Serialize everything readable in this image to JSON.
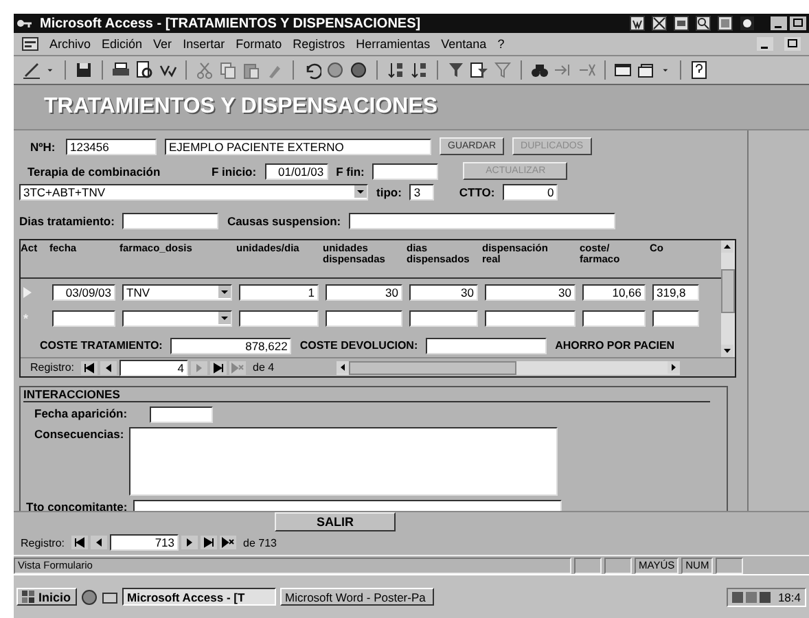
{
  "window": {
    "title": "Microsoft Access - [TRATAMIENTOS Y DISPENSACIONES]"
  },
  "menu": [
    "Archivo",
    "Edición",
    "Ver",
    "Insertar",
    "Formato",
    "Registros",
    "Herramientas",
    "Ventana",
    "?"
  ],
  "form": {
    "heading": "TRATAMIENTOS Y DISPENSACIONES",
    "patient": {
      "label": "NºH:",
      "number": "123456",
      "name": "EJEMPLO PACIENTE EXTERNO"
    },
    "buttons": [
      {
        "label": "GUARDAR",
        "disabled": false
      },
      {
        "label": "DUPLICADOS",
        "disabled": true
      }
    ],
    "therapy": {
      "label": "Terapia de combinación",
      "value": "3TC+ABT+TNV"
    },
    "start": {
      "label": "F inicio:",
      "value": "01/01/03"
    },
    "end": {
      "label": "F fin:"
    },
    "update_button": {
      "label": "ACTUALIZAR",
      "disabled": true
    },
    "type": {
      "label": "tipo:",
      "value": "3"
    },
    "ctto": {
      "label": "CTTO:",
      "value": "0"
    },
    "days": {
      "label": "Dias tratamiento:"
    },
    "suspension": {
      "label": "Causas suspension:"
    }
  },
  "subform": {
    "columns": [
      {
        "label": "Act",
        "kind": "selector"
      },
      {
        "label": "fecha",
        "kind": "text"
      },
      {
        "label": "farmaco_dosis",
        "kind": "combo"
      },
      {
        "label": "unidades/dia",
        "kind": "text"
      },
      {
        "label": "unidades\ndispensadas",
        "kind": "text"
      },
      {
        "label": "dias\ndispensados",
        "kind": "text"
      },
      {
        "label": "dispensación\nreal",
        "kind": "text"
      },
      {
        "label": "coste/\nfarmaco",
        "kind": "text"
      },
      {
        "label": "Co",
        "kind": "text"
      }
    ],
    "rows": [
      {
        "kind": "current",
        "cells": [
          "03/09/03",
          "TNV",
          "1",
          "30",
          "30",
          "30",
          "10,66",
          "319,8"
        ]
      },
      {
        "kind": "new",
        "mark": "*"
      }
    ],
    "totals": [
      {
        "label": "COSTE TRATAMIENTO:",
        "value": "878,622"
      },
      {
        "label": "COSTE DEVOLUCION:"
      },
      {
        "label": "AHORRO POR PACIEN"
      }
    ],
    "navigator": {
      "label": "Registro:",
      "current": "4",
      "total": "de 4"
    }
  },
  "interactions": {
    "title": "INTERACCIONES",
    "fields": [
      {
        "label": "Fecha aparición:",
        "kind": "short"
      },
      {
        "label": "Consecuencias:",
        "kind": "memo"
      },
      {
        "label": "Tto concomitante:",
        "kind": "line"
      }
    ]
  },
  "exit_button": "SALIR",
  "navigator": {
    "label": "Registro:",
    "current": "713",
    "total": "de 713"
  },
  "status_bar": {
    "text": "Vista Formulario",
    "indicators": [
      "MAYÚS",
      "NUM"
    ]
  },
  "taskbar": {
    "start": "Inicio",
    "tasks": [
      {
        "label": "Microsoft Access - [T",
        "selected": true
      },
      {
        "label": "Microsoft Word - Poster-Pa",
        "selected": false
      }
    ],
    "clock": "18:4"
  }
}
